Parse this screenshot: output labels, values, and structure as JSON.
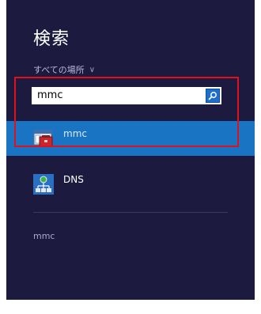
{
  "panel": {
    "title": "検索",
    "scope_label": "すべての場所",
    "scope_chevron_icon": "chevron-down-icon"
  },
  "search": {
    "value": "mmc",
    "button_icon": "search-icon",
    "button_color": "#1e6fc9"
  },
  "results": [
    {
      "label": "mmc",
      "icon": "mmc-console-icon",
      "selected": true
    },
    {
      "label": "DNS",
      "icon": "dns-server-icon",
      "selected": false
    }
  ],
  "suggestions": [
    {
      "label": "mmc"
    }
  ],
  "colors": {
    "panel_bg": "#1c1b3f",
    "selected_bg": "#1a74c4",
    "annotation": "#e1101d"
  }
}
